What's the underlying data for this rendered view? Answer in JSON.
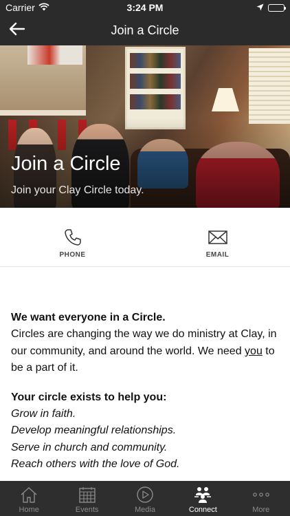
{
  "status_bar": {
    "carrier": "Carrier",
    "time": "3:24 PM",
    "icons": [
      "wifi-icon",
      "location-arrow-icon",
      "battery-icon"
    ]
  },
  "nav": {
    "title": "Join a Circle",
    "back_icon": "arrow-left-icon"
  },
  "hero": {
    "title": "Join a Circle",
    "subtitle": "Join your Clay Circle today."
  },
  "actions": [
    {
      "label": "PHONE",
      "icon": "phone-icon"
    },
    {
      "label": "EMAIL",
      "icon": "envelope-icon"
    }
  ],
  "content": {
    "heading1": "We want everyone in a Circle.",
    "para_before_link": "Circles are changing the way we do ministry at Clay, in our community, and around the world. We need ",
    "para_link": "you",
    "para_after_link": " to be a part of it.",
    "heading2": "Your circle exists to help you:",
    "list": [
      "Grow in faith.",
      "Develop meaningful relationships.",
      "Serve in church and community.",
      "Reach others with the love of God."
    ]
  },
  "tab_bar": {
    "tabs": [
      {
        "label": "Home",
        "icon": "home-icon"
      },
      {
        "label": "Events",
        "icon": "calendar-icon"
      },
      {
        "label": "Media",
        "icon": "play-circle-icon"
      },
      {
        "label": "Connect",
        "icon": "group-icon"
      },
      {
        "label": "More",
        "icon": "more-dots-icon"
      }
    ],
    "active": "Connect"
  },
  "colors": {
    "bar_background": "#2b2b2b",
    "tab_inactive": "#8c8c8c",
    "tab_active": "#ffffff",
    "text": "#111111"
  }
}
